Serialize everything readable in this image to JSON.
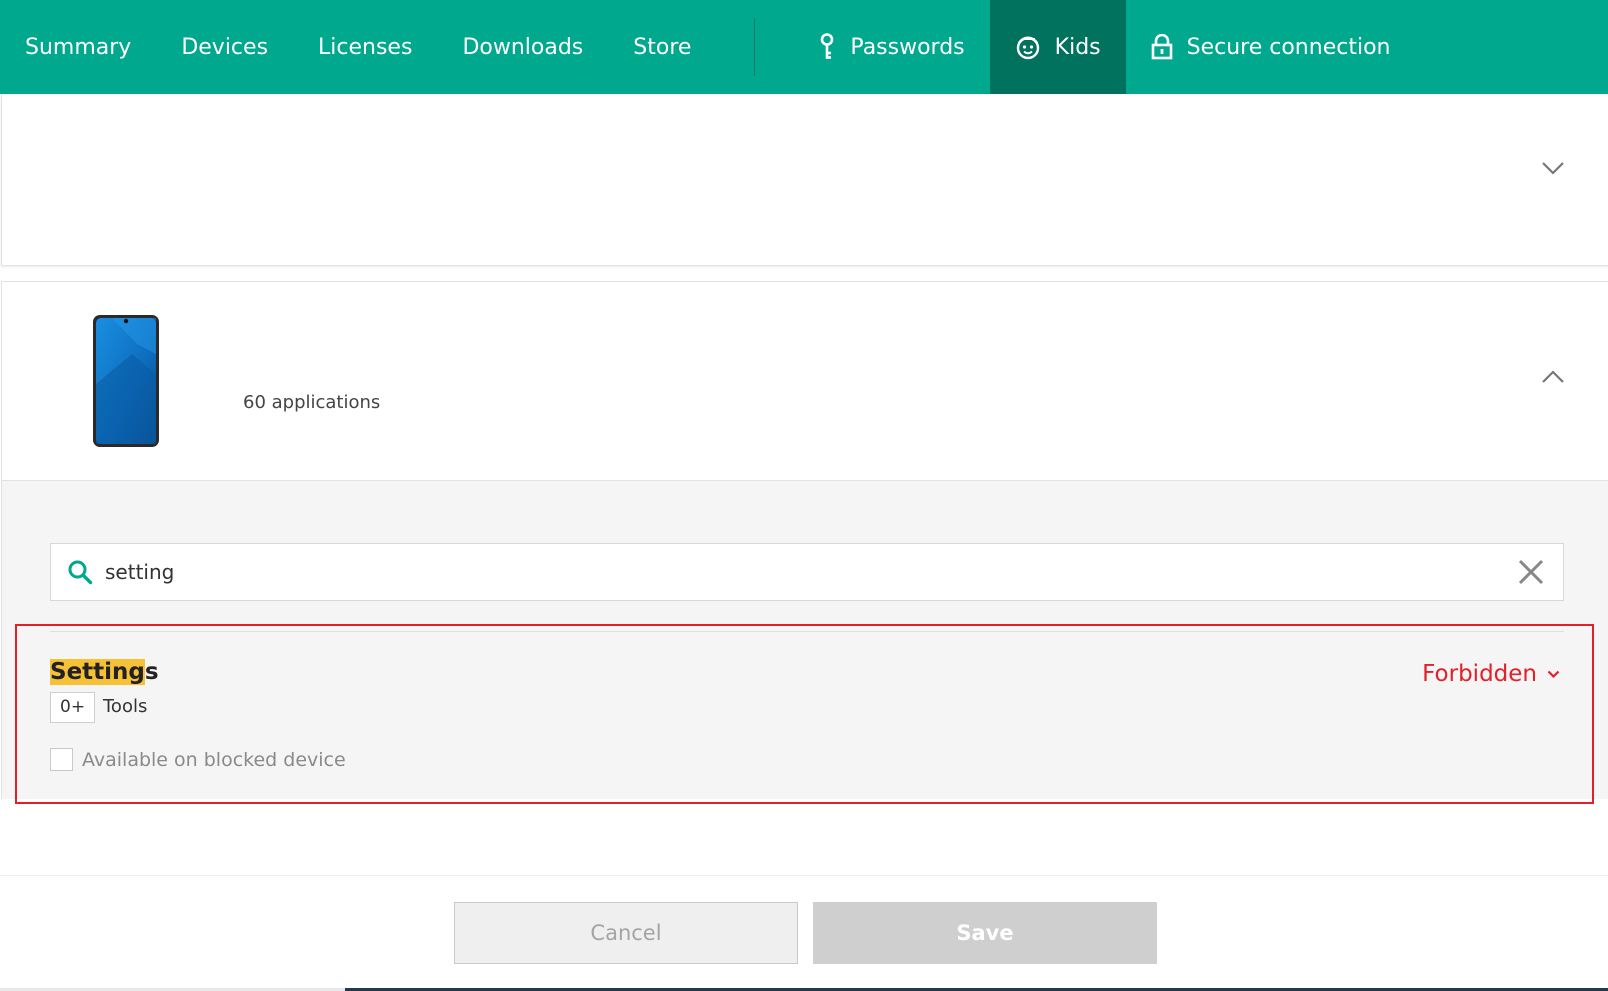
{
  "nav": {
    "items": [
      {
        "label": "Summary"
      },
      {
        "label": "Devices"
      },
      {
        "label": "Licenses"
      },
      {
        "label": "Downloads"
      },
      {
        "label": "Store"
      }
    ],
    "icon_items": [
      {
        "label": "Passwords",
        "icon": "key-icon"
      },
      {
        "label": "Kids",
        "icon": "kid-face-icon",
        "active": true
      },
      {
        "label": "Secure connection",
        "icon": "lock-icon"
      }
    ]
  },
  "device": {
    "apps_count": "60 applications",
    "icon": "smartphone-icon"
  },
  "search": {
    "value": "setting",
    "icon": "search-icon",
    "clear_icon": "close-icon"
  },
  "app": {
    "name_highlight": "Setting",
    "name_rest": "s",
    "age_rating": "0+",
    "category": "Tools",
    "available_label": "Available on blocked device",
    "status": "Forbidden"
  },
  "footer": {
    "cancel_label": "Cancel",
    "save_label": "Save"
  },
  "colors": {
    "brand": "#00a88e",
    "brand_active": "#00725e",
    "forbidden": "#e3202a",
    "highlight": "#f6c136"
  }
}
